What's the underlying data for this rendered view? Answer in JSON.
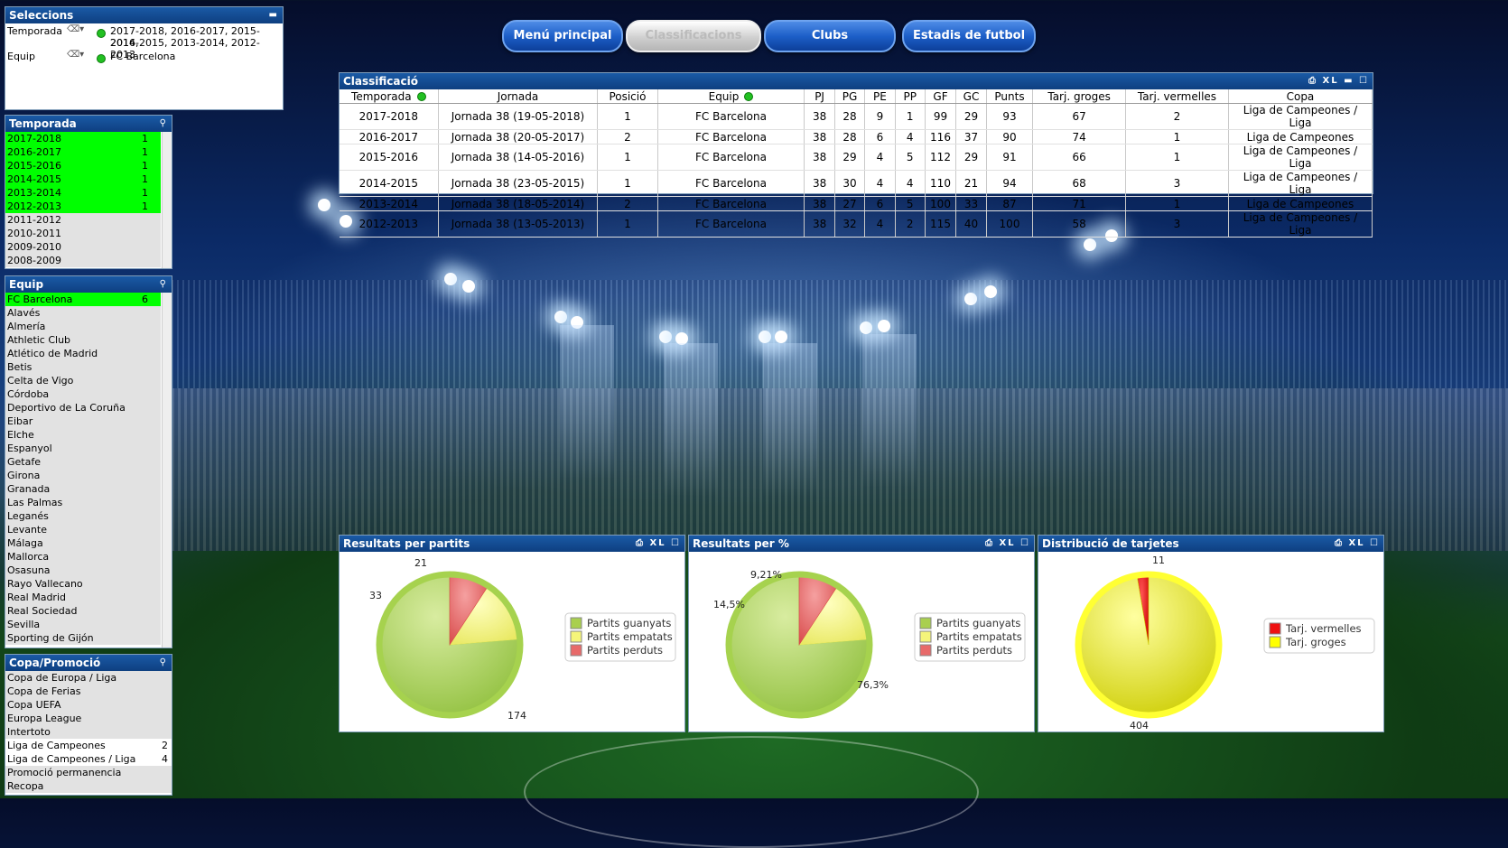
{
  "nav": {
    "buttons": [
      "Menú principal",
      "Classificacions",
      "Clubs",
      "Estadis de futbol"
    ],
    "active": 1
  },
  "selections": {
    "title": "Seleccions",
    "rows": [
      {
        "field": "Temporada",
        "value_line1": "2017-2018, 2016-2017, 2015-2016,",
        "value_line2": "2014-2015, 2013-2014, 2012-2013"
      },
      {
        "field": "Equip",
        "value_line1": "FC Barcelona",
        "value_line2": ""
      }
    ]
  },
  "temporada": {
    "title": "Temporada",
    "items": [
      {
        "label": "2017-2018",
        "count": "1",
        "state": "sel"
      },
      {
        "label": "2016-2017",
        "count": "1",
        "state": "sel"
      },
      {
        "label": "2015-2016",
        "count": "1",
        "state": "sel"
      },
      {
        "label": "2014-2015",
        "count": "1",
        "state": "sel"
      },
      {
        "label": "2013-2014",
        "count": "1",
        "state": "sel"
      },
      {
        "label": "2012-2013",
        "count": "1",
        "state": "sel"
      },
      {
        "label": "2011-2012",
        "count": "",
        "state": "gry"
      },
      {
        "label": "2010-2011",
        "count": "",
        "state": "gry"
      },
      {
        "label": "2009-2010",
        "count": "",
        "state": "gry"
      },
      {
        "label": "2008-2009",
        "count": "",
        "state": "gry"
      }
    ]
  },
  "equip": {
    "title": "Equip",
    "items": [
      {
        "label": "FC Barcelona",
        "count": "6",
        "state": "sel"
      },
      {
        "label": "Alavés",
        "count": "",
        "state": "gry"
      },
      {
        "label": "Almería",
        "count": "",
        "state": "gry"
      },
      {
        "label": "Athletic Club",
        "count": "",
        "state": "gry"
      },
      {
        "label": "Atlético de Madrid",
        "count": "",
        "state": "gry"
      },
      {
        "label": "Betis",
        "count": "",
        "state": "gry"
      },
      {
        "label": "Celta de Vigo",
        "count": "",
        "state": "gry"
      },
      {
        "label": "Córdoba",
        "count": "",
        "state": "gry"
      },
      {
        "label": "Deportivo de La Coruña",
        "count": "",
        "state": "gry"
      },
      {
        "label": "Eibar",
        "count": "",
        "state": "gry"
      },
      {
        "label": "Elche",
        "count": "",
        "state": "gry"
      },
      {
        "label": "Espanyol",
        "count": "",
        "state": "gry"
      },
      {
        "label": "Getafe",
        "count": "",
        "state": "gry"
      },
      {
        "label": "Girona",
        "count": "",
        "state": "gry"
      },
      {
        "label": "Granada",
        "count": "",
        "state": "gry"
      },
      {
        "label": "Las Palmas",
        "count": "",
        "state": "gry"
      },
      {
        "label": "Leganés",
        "count": "",
        "state": "gry"
      },
      {
        "label": "Levante",
        "count": "",
        "state": "gry"
      },
      {
        "label": "Málaga",
        "count": "",
        "state": "gry"
      },
      {
        "label": "Mallorca",
        "count": "",
        "state": "gry"
      },
      {
        "label": "Osasuna",
        "count": "",
        "state": "gry"
      },
      {
        "label": "Rayo Vallecano",
        "count": "",
        "state": "gry"
      },
      {
        "label": "Real Madrid",
        "count": "",
        "state": "gry"
      },
      {
        "label": "Real Sociedad",
        "count": "",
        "state": "gry"
      },
      {
        "label": "Sevilla",
        "count": "",
        "state": "gry"
      },
      {
        "label": "Sporting de Gijón",
        "count": "",
        "state": "gry"
      }
    ]
  },
  "copa": {
    "title": "Copa/Promoció",
    "items": [
      {
        "label": "Copa de Europa / Liga",
        "count": "",
        "state": "gry"
      },
      {
        "label": "Copa de Ferias",
        "count": "",
        "state": "gry"
      },
      {
        "label": "Copa UEFA",
        "count": "",
        "state": "gry"
      },
      {
        "label": "Europa League",
        "count": "",
        "state": "gry"
      },
      {
        "label": "Intertoto",
        "count": "",
        "state": "gry"
      },
      {
        "label": "Liga de Campeones",
        "count": "2",
        "state": "alt"
      },
      {
        "label": "Liga de Campeones / Liga",
        "count": "4",
        "state": "alt"
      },
      {
        "label": "Promoció permanencia",
        "count": "",
        "state": "gry"
      },
      {
        "label": "Recopa",
        "count": "",
        "state": "gry"
      }
    ]
  },
  "classificacio": {
    "title": "Classificació",
    "controls": "XL",
    "columns": [
      "Temporada",
      "Jornada",
      "Posició",
      "Equip",
      "PJ",
      "PG",
      "PE",
      "PP",
      "GF",
      "GC",
      "Punts",
      "Tarj. groges",
      "Tarj. vermelles",
      "Copa"
    ],
    "rows": [
      [
        "2017-2018",
        "Jornada 38 (19-05-2018)",
        "1",
        "FC Barcelona",
        "38",
        "28",
        "9",
        "1",
        "99",
        "29",
        "93",
        "67",
        "2",
        "Liga de Campeones / Liga"
      ],
      [
        "2016-2017",
        "Jornada 38 (20-05-2017)",
        "2",
        "FC Barcelona",
        "38",
        "28",
        "6",
        "4",
        "116",
        "37",
        "90",
        "74",
        "1",
        "Liga de Campeones"
      ],
      [
        "2015-2016",
        "Jornada 38 (14-05-2016)",
        "1",
        "FC Barcelona",
        "38",
        "29",
        "4",
        "5",
        "112",
        "29",
        "91",
        "66",
        "1",
        "Liga de Campeones / Liga"
      ],
      [
        "2014-2015",
        "Jornada 38 (23-05-2015)",
        "1",
        "FC Barcelona",
        "38",
        "30",
        "4",
        "4",
        "110",
        "21",
        "94",
        "68",
        "3",
        "Liga de Campeones / Liga"
      ],
      [
        "2013-2014",
        "Jornada 38 (18-05-2014)",
        "2",
        "FC Barcelona",
        "38",
        "27",
        "6",
        "5",
        "100",
        "33",
        "87",
        "71",
        "1",
        "Liga de Campeones"
      ],
      [
        "2012-2013",
        "Jornada 38 (13-05-2013)",
        "1",
        "FC Barcelona",
        "38",
        "32",
        "4",
        "2",
        "115",
        "40",
        "100",
        "58",
        "3",
        "Liga de Campeones / Liga"
      ]
    ]
  },
  "colors": {
    "win": "#a9cf4f",
    "draw": "#f5f57a",
    "loss": "#e86a6a",
    "red": "#ee1111",
    "yellow": "#ffff00",
    "header": "#0e3f80",
    "selected": "#00ff00"
  },
  "chart_data": [
    {
      "type": "pie",
      "title": "Resultats per partits",
      "controls": "XL",
      "slices": [
        {
          "name": "Partits guanyats",
          "value": 174,
          "label": "174"
        },
        {
          "name": "Partits empatats",
          "value": 33,
          "label": "33"
        },
        {
          "name": "Partits perduts",
          "value": 21,
          "label": "21"
        }
      ],
      "legend": "right"
    },
    {
      "type": "pie",
      "title": "Resultats per %",
      "controls": "XL",
      "slices": [
        {
          "name": "Partits guanyats",
          "value": 76.3,
          "label": "76,3%"
        },
        {
          "name": "Partits empatats",
          "value": 14.5,
          "label": "14,5%"
        },
        {
          "name": "Partits perduts",
          "value": 9.21,
          "label": "9,21%"
        }
      ],
      "legend": "right"
    },
    {
      "type": "pie",
      "title": "Distribució de tarjetes",
      "controls": "XL",
      "slices": [
        {
          "name": "Tarj. vermelles",
          "value": 11,
          "label": "11"
        },
        {
          "name": "Tarj. groges",
          "value": 404,
          "label": "404"
        }
      ],
      "legend": "right"
    }
  ]
}
